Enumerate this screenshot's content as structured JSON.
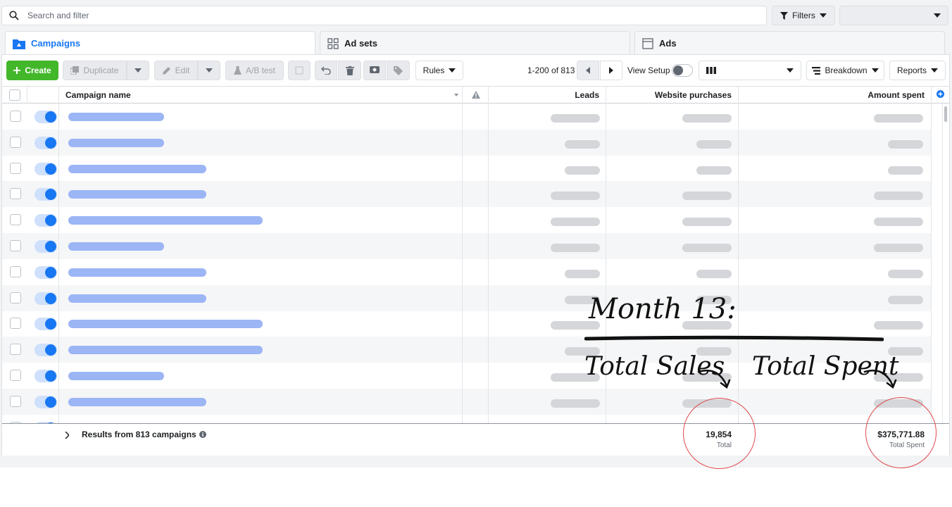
{
  "search": {
    "placeholder": "Search and filter"
  },
  "filters": {
    "label": "Filters"
  },
  "tabs": [
    {
      "label": "Campaigns"
    },
    {
      "label": "Ad sets"
    },
    {
      "label": "Ads"
    }
  ],
  "toolbar": {
    "create": "Create",
    "duplicate": "Duplicate",
    "edit": "Edit",
    "ab_test": "A/B test",
    "rules": "Rules",
    "pagination": "1-200 of 813",
    "view_setup": "View Setup",
    "breakdown": "Breakdown",
    "reports": "Reports"
  },
  "table": {
    "columns": {
      "campaign_name": "Campaign name",
      "leads": "Leads",
      "website_purchases": "Website purchases",
      "amount_spent": "Amount spent"
    },
    "rows": [
      {
        "active": true
      },
      {
        "active": true
      },
      {
        "active": true
      },
      {
        "active": true
      },
      {
        "active": true
      },
      {
        "active": true
      },
      {
        "active": true
      },
      {
        "active": true
      },
      {
        "active": true
      },
      {
        "active": true
      },
      {
        "active": true
      },
      {
        "active": true
      }
    ],
    "footer": {
      "label": "Results from 813 campaigns",
      "purchases_total": "19,854",
      "purchases_sub": "Total",
      "spent_total": "$375,771.88",
      "spent_sub": "Total Spent"
    }
  },
  "annotation": {
    "heading": "Month 13:",
    "sales_label": "Total Sales",
    "spent_label": "Total Spent",
    "color": "#e0474c"
  },
  "colors": {
    "accent": "#1877f2",
    "create": "#42b72a"
  }
}
